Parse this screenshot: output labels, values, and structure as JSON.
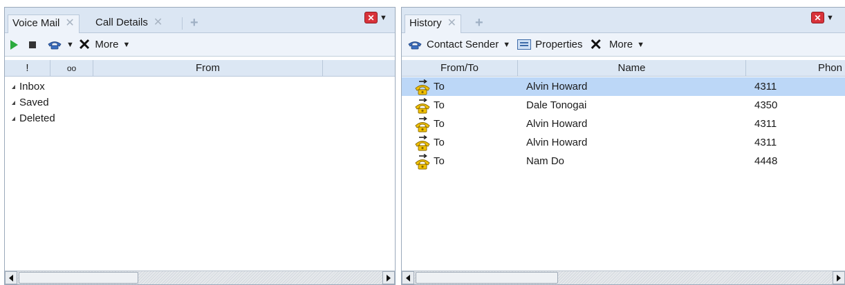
{
  "left_pane": {
    "tabs": [
      {
        "label": "Voice Mail",
        "active": true
      },
      {
        "label": "Call Details",
        "active": false
      }
    ],
    "toolbar": {
      "more_label": "More"
    },
    "columns": [
      "!",
      "oo",
      "From"
    ],
    "folders": [
      "Inbox",
      "Saved",
      "Deleted"
    ]
  },
  "right_pane": {
    "tabs": [
      {
        "label": "History",
        "active": true
      }
    ],
    "toolbar": {
      "contact_sender_label": "Contact Sender",
      "properties_label": "Properties",
      "more_label": "More"
    },
    "columns": [
      "From/To",
      "Name",
      "Phon"
    ],
    "rows": [
      {
        "direction": "To",
        "name": "Alvin Howard",
        "phone": "4311",
        "selected": true
      },
      {
        "direction": "To",
        "name": "Dale Tonogai",
        "phone": "4350",
        "selected": false
      },
      {
        "direction": "To",
        "name": "Alvin Howard",
        "phone": "4311",
        "selected": false
      },
      {
        "direction": "To",
        "name": "Alvin Howard",
        "phone": "4311",
        "selected": false
      },
      {
        "direction": "To",
        "name": "Nam Do",
        "phone": "4448",
        "selected": false
      }
    ]
  },
  "colors": {
    "tab_bar": "#dbe6f3",
    "selected_row": "#bcd7f7",
    "play_green": "#2cab3e",
    "close_red": "#d8323a",
    "call_icon_yellow": "#f2c200"
  }
}
